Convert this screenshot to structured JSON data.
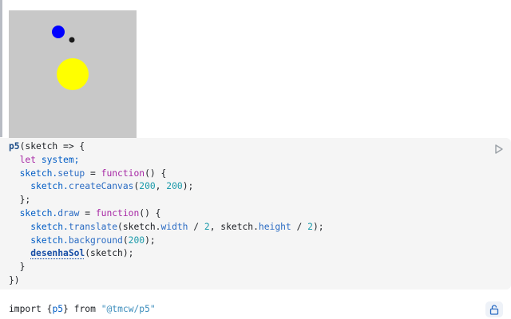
{
  "sketch": {
    "background_color": "#c8c8c8",
    "shapes": [
      {
        "name": "blue-planet",
        "color": "#0000ff"
      },
      {
        "name": "black-moon",
        "color": "#1a1a1a"
      },
      {
        "name": "yellow-sun",
        "color": "#ffff00"
      }
    ]
  },
  "code": {
    "lines": {
      "l1a": "p5",
      "l1b": "(sketch => {",
      "l2a": "let",
      "l2b": "system;",
      "l3a": "sketch.",
      "l3b": "setup",
      "l3c": " = ",
      "l3d": "function",
      "l3e": "() {",
      "l4a": "sketch.",
      "l4b": "createCanvas",
      "l4c": "(",
      "l4d": "200",
      "l4e": ", ",
      "l4f": "200",
      "l4g": ");",
      "l5": "};",
      "l6a": "sketch.",
      "l6b": "draw",
      "l6c": " = ",
      "l6d": "function",
      "l6e": "() {",
      "l7a": "sketch.",
      "l7b": "translate",
      "l7c": "(sketch.",
      "l7d": "width",
      "l7e": " / ",
      "l7f": "2",
      "l7g": ", sketch.",
      "l7h": "height",
      "l7i": " / ",
      "l7j": "2",
      "l7k": ");",
      "l8a": "sketch.",
      "l8b": "background",
      "l8c": "(",
      "l8d": "200",
      "l8e": ");",
      "l9a": "desenhaSol",
      "l9b": "(sketch);",
      "l10": "}",
      "l11": "})"
    }
  },
  "import_cell": {
    "kw_import": "import",
    "open_brace": "{",
    "name": "p5",
    "close_brace": "}",
    "kw_from": "from",
    "module": "\"@tmcw/p5\""
  },
  "icons": {
    "run": "play-icon",
    "lock": "lock-open-icon"
  }
}
